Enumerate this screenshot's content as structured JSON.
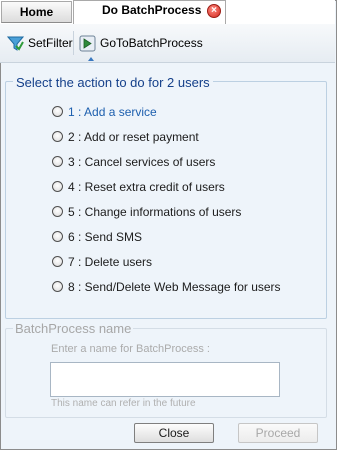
{
  "tabs": [
    {
      "label": "Home"
    },
    {
      "label": "Do BatchProcess",
      "close_icon": "close-icon"
    }
  ],
  "toolbar": {
    "setfilter_label": "SetFilter",
    "setfilter_icon": "filter-icon",
    "goto_label": "GoToBatchProcess",
    "goto_icon": "goto-arrow-icon"
  },
  "action_group": {
    "legend": "Select the action to do for 2 users",
    "options": [
      "1 : Add a service",
      "2 : Add or reset payment",
      "3 : Cancel services of users",
      "4 : Reset extra credit of users",
      "5 : Change informations of users",
      "6 : Send SMS",
      "7 : Delete users",
      "8 : Send/Delete Web Message for users"
    ]
  },
  "name_group": {
    "legend": "BatchProcess name",
    "hint": "Enter a name for BatchProcess :",
    "value": "",
    "note": "This name can refer in the future"
  },
  "buttons": {
    "close_label": "Close",
    "proceed_label": "Proceed"
  },
  "colors": {
    "panel_bg": "#eef4fa",
    "legend_blue": "#15408a",
    "link_blue": "#1d5fae",
    "disabled_gray": "#a8a8a8",
    "close_tab_red": "#d2281e"
  }
}
